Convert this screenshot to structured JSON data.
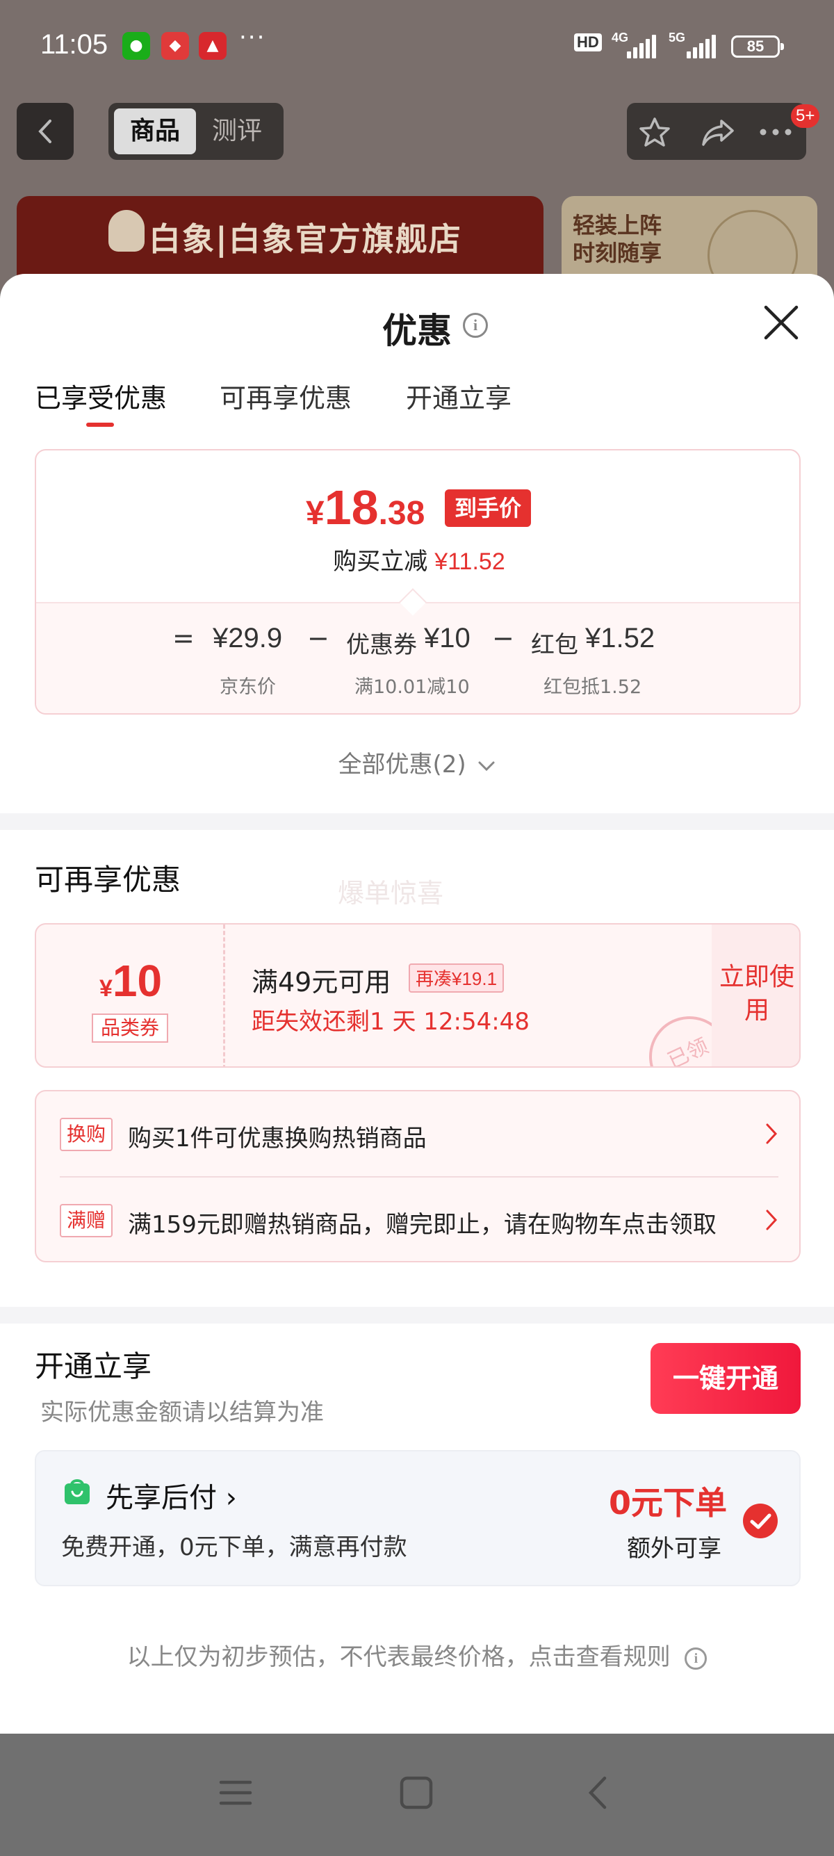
{
  "status_bar": {
    "time": "11:05",
    "dots": "···",
    "hd_label": "HD",
    "net1": "4G",
    "net2": "5G",
    "battery": "85"
  },
  "header": {
    "tab_product": "商品",
    "tab_review": "测评",
    "badge": "5+"
  },
  "banner": {
    "store_name": "白象|白象官方旗舰店",
    "right_text": "轻装上阵 时刻随享"
  },
  "sheet": {
    "title": "优惠",
    "info_glyph": "i",
    "tabs": [
      "已享受优惠",
      "可再享优惠",
      "开通立享"
    ]
  },
  "price_card": {
    "yen": "¥",
    "price_int": "18",
    "price_dec": ".38",
    "badge": "到手价",
    "reduce_label": "购买立减",
    "reduce_amount": "¥11.52",
    "eq": "=",
    "minus": "−",
    "jd_price": "¥29.9",
    "jd_label": "京东价",
    "coupon_label": "优惠券",
    "coupon_value": "¥10",
    "coupon_sub": "满10.01减10",
    "redpacket_label": "红包",
    "redpacket_value": "¥1.52",
    "redpacket_sub": "红包抵1.52"
  },
  "all_offers": "全部优惠(2)",
  "more_offers": {
    "title": "可再享优惠",
    "watermark": "爆单惊喜",
    "coupon": {
      "yen": "¥",
      "amount": "10",
      "type": "品类券",
      "condition": "满49元可用",
      "extra": "再凑¥19.1",
      "timer": "距失效还剩1 天 12:54:48",
      "use_label": "立即使用",
      "stamp": "已领"
    },
    "promos": [
      {
        "tag": "换购",
        "text": "购买1件可优惠换购热销商品"
      },
      {
        "tag": "满赠",
        "text": "满159元即赠热销商品，赠完即止，请在购物车点击领取"
      }
    ]
  },
  "open_section": {
    "title": "开通立享",
    "subtitle": "实际优惠金额请以结算为准",
    "button": "一键开通",
    "pay_title": "先享后付 ›",
    "pay_desc": "免费开通，0元下单，满意再付款",
    "pay_zero": "0元下单",
    "pay_extra": "额外可享"
  },
  "disclaimer": "以上仅为初步预估，不代表最终价格，点击查看规则",
  "colors": {
    "accent": "#e5312f",
    "pink_border": "#f5cfd3",
    "pay_icon": "#2fc26b"
  }
}
